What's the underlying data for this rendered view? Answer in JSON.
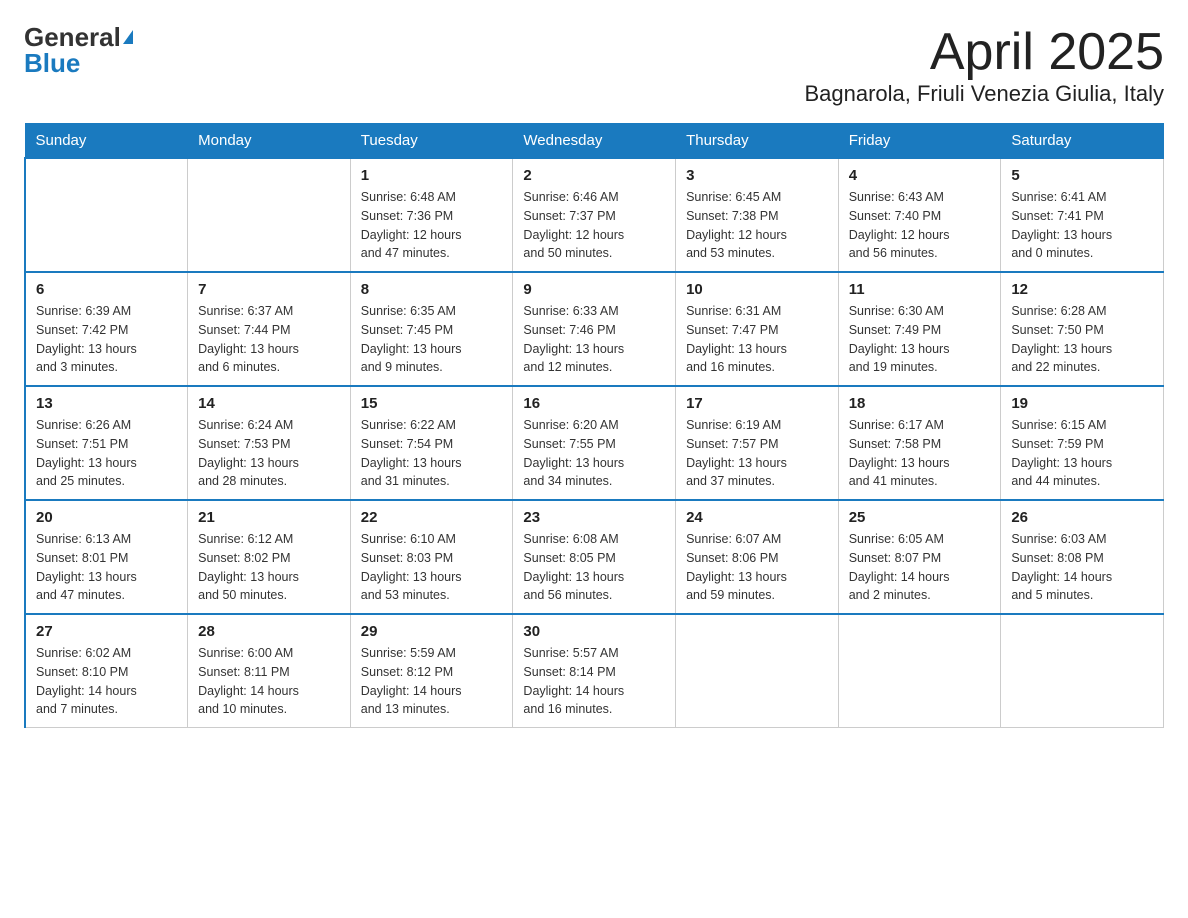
{
  "logo": {
    "general": "General",
    "blue": "Blue"
  },
  "header": {
    "month": "April 2025",
    "location": "Bagnarola, Friuli Venezia Giulia, Italy"
  },
  "weekdays": [
    "Sunday",
    "Monday",
    "Tuesday",
    "Wednesday",
    "Thursday",
    "Friday",
    "Saturday"
  ],
  "weeks": [
    [
      {
        "day": "",
        "info": ""
      },
      {
        "day": "",
        "info": ""
      },
      {
        "day": "1",
        "info": "Sunrise: 6:48 AM\nSunset: 7:36 PM\nDaylight: 12 hours\nand 47 minutes."
      },
      {
        "day": "2",
        "info": "Sunrise: 6:46 AM\nSunset: 7:37 PM\nDaylight: 12 hours\nand 50 minutes."
      },
      {
        "day": "3",
        "info": "Sunrise: 6:45 AM\nSunset: 7:38 PM\nDaylight: 12 hours\nand 53 minutes."
      },
      {
        "day": "4",
        "info": "Sunrise: 6:43 AM\nSunset: 7:40 PM\nDaylight: 12 hours\nand 56 minutes."
      },
      {
        "day": "5",
        "info": "Sunrise: 6:41 AM\nSunset: 7:41 PM\nDaylight: 13 hours\nand 0 minutes."
      }
    ],
    [
      {
        "day": "6",
        "info": "Sunrise: 6:39 AM\nSunset: 7:42 PM\nDaylight: 13 hours\nand 3 minutes."
      },
      {
        "day": "7",
        "info": "Sunrise: 6:37 AM\nSunset: 7:44 PM\nDaylight: 13 hours\nand 6 minutes."
      },
      {
        "day": "8",
        "info": "Sunrise: 6:35 AM\nSunset: 7:45 PM\nDaylight: 13 hours\nand 9 minutes."
      },
      {
        "day": "9",
        "info": "Sunrise: 6:33 AM\nSunset: 7:46 PM\nDaylight: 13 hours\nand 12 minutes."
      },
      {
        "day": "10",
        "info": "Sunrise: 6:31 AM\nSunset: 7:47 PM\nDaylight: 13 hours\nand 16 minutes."
      },
      {
        "day": "11",
        "info": "Sunrise: 6:30 AM\nSunset: 7:49 PM\nDaylight: 13 hours\nand 19 minutes."
      },
      {
        "day": "12",
        "info": "Sunrise: 6:28 AM\nSunset: 7:50 PM\nDaylight: 13 hours\nand 22 minutes."
      }
    ],
    [
      {
        "day": "13",
        "info": "Sunrise: 6:26 AM\nSunset: 7:51 PM\nDaylight: 13 hours\nand 25 minutes."
      },
      {
        "day": "14",
        "info": "Sunrise: 6:24 AM\nSunset: 7:53 PM\nDaylight: 13 hours\nand 28 minutes."
      },
      {
        "day": "15",
        "info": "Sunrise: 6:22 AM\nSunset: 7:54 PM\nDaylight: 13 hours\nand 31 minutes."
      },
      {
        "day": "16",
        "info": "Sunrise: 6:20 AM\nSunset: 7:55 PM\nDaylight: 13 hours\nand 34 minutes."
      },
      {
        "day": "17",
        "info": "Sunrise: 6:19 AM\nSunset: 7:57 PM\nDaylight: 13 hours\nand 37 minutes."
      },
      {
        "day": "18",
        "info": "Sunrise: 6:17 AM\nSunset: 7:58 PM\nDaylight: 13 hours\nand 41 minutes."
      },
      {
        "day": "19",
        "info": "Sunrise: 6:15 AM\nSunset: 7:59 PM\nDaylight: 13 hours\nand 44 minutes."
      }
    ],
    [
      {
        "day": "20",
        "info": "Sunrise: 6:13 AM\nSunset: 8:01 PM\nDaylight: 13 hours\nand 47 minutes."
      },
      {
        "day": "21",
        "info": "Sunrise: 6:12 AM\nSunset: 8:02 PM\nDaylight: 13 hours\nand 50 minutes."
      },
      {
        "day": "22",
        "info": "Sunrise: 6:10 AM\nSunset: 8:03 PM\nDaylight: 13 hours\nand 53 minutes."
      },
      {
        "day": "23",
        "info": "Sunrise: 6:08 AM\nSunset: 8:05 PM\nDaylight: 13 hours\nand 56 minutes."
      },
      {
        "day": "24",
        "info": "Sunrise: 6:07 AM\nSunset: 8:06 PM\nDaylight: 13 hours\nand 59 minutes."
      },
      {
        "day": "25",
        "info": "Sunrise: 6:05 AM\nSunset: 8:07 PM\nDaylight: 14 hours\nand 2 minutes."
      },
      {
        "day": "26",
        "info": "Sunrise: 6:03 AM\nSunset: 8:08 PM\nDaylight: 14 hours\nand 5 minutes."
      }
    ],
    [
      {
        "day": "27",
        "info": "Sunrise: 6:02 AM\nSunset: 8:10 PM\nDaylight: 14 hours\nand 7 minutes."
      },
      {
        "day": "28",
        "info": "Sunrise: 6:00 AM\nSunset: 8:11 PM\nDaylight: 14 hours\nand 10 minutes."
      },
      {
        "day": "29",
        "info": "Sunrise: 5:59 AM\nSunset: 8:12 PM\nDaylight: 14 hours\nand 13 minutes."
      },
      {
        "day": "30",
        "info": "Sunrise: 5:57 AM\nSunset: 8:14 PM\nDaylight: 14 hours\nand 16 minutes."
      },
      {
        "day": "",
        "info": ""
      },
      {
        "day": "",
        "info": ""
      },
      {
        "day": "",
        "info": ""
      }
    ]
  ]
}
